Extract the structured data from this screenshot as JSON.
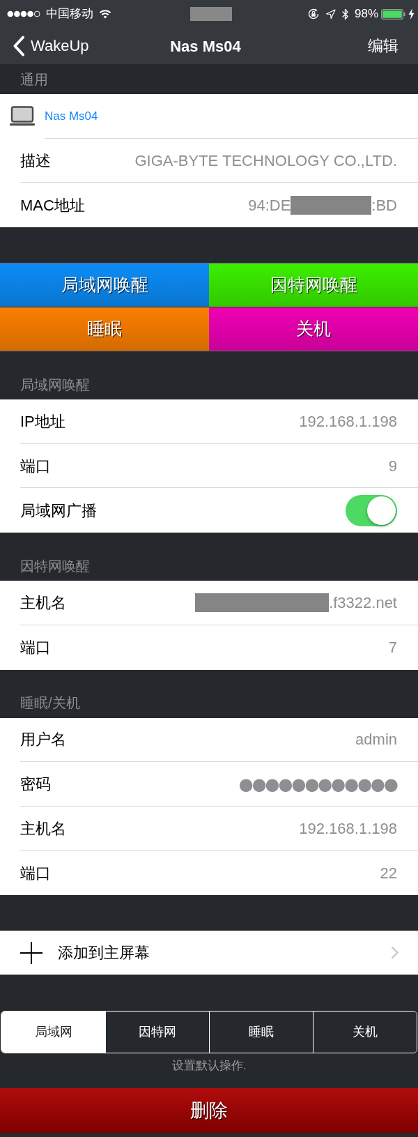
{
  "status_bar": {
    "carrier": "中国移动",
    "time_redacted": true,
    "battery": "98%"
  },
  "nav_bar": {
    "back": "WakeUp",
    "title": "Nas Ms04",
    "action": "编辑"
  },
  "content": [
    {
      "kind": "section",
      "header": "通用",
      "rows": [
        {
          "kind": "device",
          "label": "Nas Ms04"
        },
        {
          "kind": "value",
          "label": "描述",
          "value": "GIGA-BYTE TECHNOLOGY CO.,LTD."
        },
        {
          "kind": "value",
          "label": "MAC地址",
          "value_parts": [
            {
              "kind": "text",
              "text": "94:DE"
            },
            {
              "kind": "redacted"
            },
            {
              "kind": "text",
              "text": ":BD"
            }
          ]
        }
      ]
    },
    {
      "kind": "actions",
      "buttons": [
        {
          "label": "局域网唤醒",
          "color": "#0c8cf6"
        },
        {
          "label": "因特网唤醒",
          "color": "#3cee00"
        },
        {
          "label": "睡眠",
          "color": "#fb7f00"
        },
        {
          "label": "关机",
          "color": "#ef00b4"
        }
      ]
    },
    {
      "kind": "section",
      "header": "局域网唤醒",
      "rows": [
        {
          "kind": "value",
          "label": "IP地址",
          "value": "192.168.1.198"
        },
        {
          "kind": "value",
          "label": "端口",
          "value": "9"
        },
        {
          "kind": "toggle",
          "label": "局域网广播",
          "on": true
        }
      ]
    },
    {
      "kind": "section",
      "header": "因特网唤醒",
      "rows": [
        {
          "kind": "value",
          "label": "主机名",
          "value_parts": [
            {
              "kind": "redacted"
            },
            {
              "kind": "text",
              "text": ".f3322.net"
            }
          ]
        },
        {
          "kind": "value",
          "label": "端口",
          "value": "7"
        }
      ]
    },
    {
      "kind": "section",
      "header": "睡眠/关机",
      "rows": [
        {
          "kind": "value",
          "label": "用户名",
          "value": "admin"
        },
        {
          "kind": "password",
          "label": "密码",
          "value": "●●●●●●●●●●●●"
        },
        {
          "kind": "value",
          "label": "主机名",
          "value": "192.168.1.198"
        },
        {
          "kind": "value",
          "label": "端口",
          "value": "22"
        }
      ]
    },
    {
      "kind": "link_row",
      "label": "添加到主屏幕"
    },
    {
      "kind": "segmented",
      "segments": [
        {
          "label": "局域网",
          "selected": true
        },
        {
          "label": "因特网",
          "selected": false
        },
        {
          "label": "睡眠",
          "selected": false
        },
        {
          "label": "关机",
          "selected": false
        }
      ],
      "footer": "设置默认操作."
    },
    {
      "kind": "button",
      "label": "删除"
    }
  ]
}
